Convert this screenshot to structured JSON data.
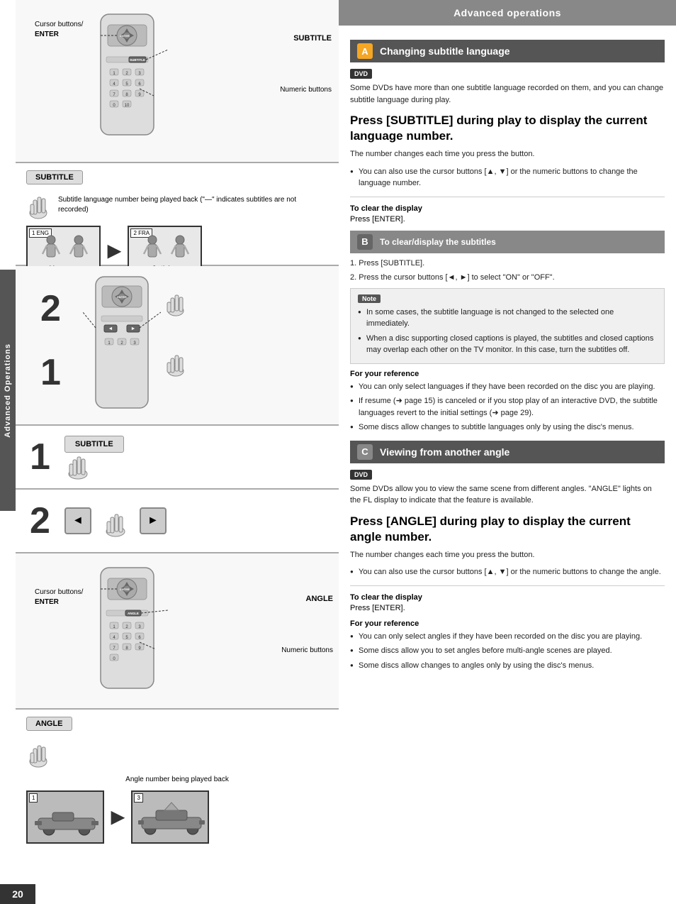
{
  "header": {
    "title": "Advanced operations"
  },
  "page_number": "20",
  "side_tab": "Advanced Operations",
  "sections": {
    "a": {
      "label": "A",
      "diagram_labels": {
        "cursor": "Cursor\nbuttons/",
        "enter": "ENTER",
        "subtitle": "SUBTITLE",
        "numeric": "Numeric\nbuttons"
      },
      "subtitle_chip": "SUBTITLE",
      "subtitle_note": "Subtitle language number being played back\n(\"—\" indicates subtitles are not recorded)",
      "screen1": {
        "badge": "1  ENG",
        "text": "I love you"
      },
      "screen2": {
        "badge": "2  FRA",
        "text": "Je t'aime"
      }
    },
    "b": {
      "label": "B",
      "step2": "2",
      "step1": "1"
    },
    "c": {
      "label": "C",
      "diagram_labels": {
        "cursor": "Cursor\nbuttons/",
        "enter": "ENTER",
        "angle": "ANGLE",
        "numeric": "Numeric\nbuttons"
      },
      "angle_chip": "ANGLE",
      "angle_note": "Angle number being played back",
      "screen1_badge": "1",
      "screen2_badge": "3"
    }
  },
  "steps": {
    "step1_label": "1",
    "step2_label": "2",
    "subtitle_btn": "SUBTITLE"
  },
  "right": {
    "header": "Advanced operations",
    "section_a": {
      "badge": "A",
      "title": "Changing subtitle language",
      "dvd_badge": "DVD",
      "body": "Some DVDs have more than one subtitle language recorded on them, and you can change subtitle language during play.",
      "press_heading": "Press [SUBTITLE] during play to display the current language number.",
      "sub_body": "The number changes each time you press the button.",
      "bullet1": "You can also use the cursor buttons [▲, ▼] or the numeric buttons to change the language number.",
      "to_clear_label": "To clear the display",
      "to_clear_body": "Press [ENTER]."
    },
    "section_b": {
      "badge": "B",
      "title": "To clear/display the subtitles",
      "step1": "1.  Press [SUBTITLE].",
      "step2": "2.  Press the cursor buttons [◄, ►] to select \"ON\" or \"OFF\".",
      "note_label": "Note",
      "note1": "In some cases, the subtitle language is not changed to the selected one immediately.",
      "note2": "When a disc supporting closed captions is played, the subtitles and closed captions may overlap each other on the TV monitor. In this case, turn the subtitles off.",
      "for_ref_label": "For your reference",
      "ref1": "You can only select languages if they have been recorded on the disc you are playing.",
      "ref2": "If resume (➜ page 15) is canceled or if you stop play of an interactive DVD, the subtitle languages revert to the initial settings (➜ page 29).",
      "ref3": "Some discs allow changes to subtitle languages only by using the disc's menus."
    },
    "section_c": {
      "badge": "C",
      "title": "Viewing from another angle",
      "dvd_badge": "DVD",
      "body": "Some DVDs allow you to view the same scene from different angles. \"ANGLE\" lights on the FL display to indicate that the feature is available.",
      "press_heading": "Press [ANGLE] during play to display the current angle number.",
      "sub_body": "The number changes each time you press the button.",
      "bullet1": "You can also use the cursor buttons [▲, ▼] or the numeric buttons to change the angle.",
      "to_clear_label": "To clear the display",
      "to_clear_body": "Press [ENTER].",
      "for_ref_label": "For your reference",
      "ref1": "You can only select angles if they have been recorded on the disc you are playing.",
      "ref2": "Some discs allow you to set angles before multi-angle scenes are played.",
      "ref3": "Some discs allow changes to angles only by using the disc's menus."
    }
  }
}
